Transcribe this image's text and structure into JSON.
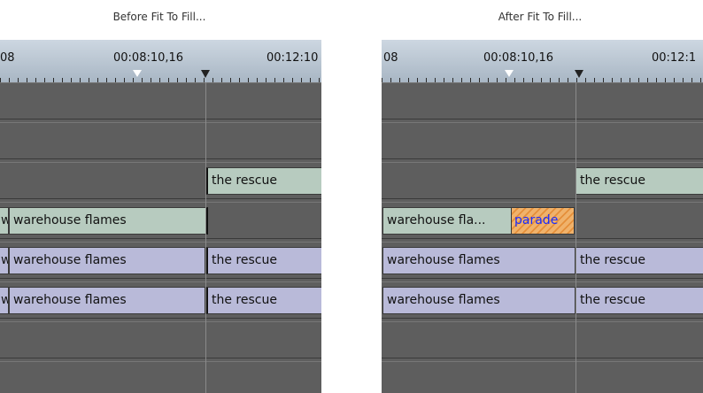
{
  "captions": {
    "before": "Before Fit To Fill...",
    "after": "After Fit To Fill..."
  },
  "before": {
    "ruler": {
      "tc_left": "08",
      "tc_mid": "00:08:10,16",
      "tc_right": "00:12:10"
    },
    "clips": {
      "v3_right": "the rescue",
      "v2_left_stub": "w",
      "v2_left": "warehouse flames",
      "v1_left_stub": "w",
      "v1_left": "warehouse flames",
      "v1_right": "the rescue",
      "a1_left_stub": "w",
      "a1_left": "warehouse flames",
      "a1_right": "the rescue"
    }
  },
  "after": {
    "ruler": {
      "tc_left": "08",
      "tc_mid": "00:08:10,16",
      "tc_right": "00:12:1"
    },
    "clips": {
      "v3_right": "the rescue",
      "v2_left": "warehouse fla...",
      "v2_fill": "parade",
      "v1_left": "warehouse flames",
      "v1_right": "the rescue",
      "a1_left": "warehouse flames",
      "a1_right": "the rescue"
    }
  }
}
